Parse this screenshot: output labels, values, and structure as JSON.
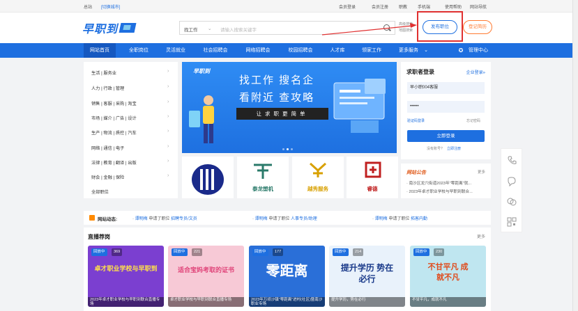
{
  "topbar": {
    "location": "总站",
    "switch_city": "[切换城市]",
    "links": [
      "会员登录",
      "会员注册",
      "职教",
      "手机端",
      "使用帮助",
      "网站导航"
    ]
  },
  "header": {
    "logo_text": "早职到",
    "search_type": "找工作",
    "search_placeholder": "请输入搜索关键字",
    "adv1": "高级搜索",
    "adv2": "地图搜索",
    "post_job": "发布职位",
    "post_resume": "登记简历"
  },
  "nav": {
    "items": [
      "网站首页",
      "全职岗位",
      "灵活就业",
      "社会招聘会",
      "网络招聘会",
      "校园招聘会",
      "人才库",
      "领家工作",
      "更多服务"
    ],
    "admin": "管理中心"
  },
  "categories": [
    "生活 | 服务业",
    "人力 | 行政 | 管理",
    "销售 | 客服 | 采购 | 淘宝",
    "市场 | 媒介 | 广告 | 设计",
    "生产 | 物流 | 质控 | 汽车",
    "网络 | 通信 | 电子",
    "法律 | 教育 | 翻译 | 出版",
    "财会 | 金融 | 保险",
    "全部职位"
  ],
  "banner": {
    "logo": "早职到",
    "line1": "找工作  搜名企",
    "line2": "看附近  查攻略",
    "slogan": "让求职更简单"
  },
  "companies": [
    {
      "name": "",
      "color": "#1a2a8a"
    },
    {
      "name": "泰龙塑机",
      "color": "#2a7a6a"
    },
    {
      "name": "越秀服务",
      "color": "#d8a000"
    },
    {
      "name": "睿德",
      "color": "#c02020"
    }
  ],
  "login": {
    "title": "求职者登录",
    "enterprise": "企业登录»",
    "username": "早小职004客服",
    "password": "••••••",
    "sms_login": "验证码登录",
    "forgot": "忘记密码",
    "button": "立即登录",
    "no_account": "没有账号?",
    "register": "立即注册"
  },
  "notice": {
    "title": "网站公告",
    "more": "更多",
    "items": [
      "· 南沙区龙穴街道2023年\"零距离\"就...",
      "· 2023年卓才职业学校与早职到联合..."
    ]
  },
  "dynamics": {
    "label": "网站动态:",
    "entries": [
      {
        "user": "谭明梅",
        "action": "申请了职位",
        "job": "招聘专员/文员"
      },
      {
        "user": "谭明梅",
        "action": "申请了职位",
        "job": "人事专员/助理"
      },
      {
        "user": "谭明梅",
        "action": "申请了职位",
        "job": "拓客内勤"
      }
    ]
  },
  "live": {
    "title": "直播荐岗",
    "more": "更多",
    "cards": [
      {
        "badge": "回放中",
        "count": "369",
        "big": "卓才职业学校与早职到",
        "caption": "2023年卓才职业学校与早职到联合直播专场",
        "bg": "#7b3fd0"
      },
      {
        "badge": "回放中",
        "count": "221",
        "big": "适合宝妈考取的证书",
        "caption": "卓才职业学校与早职到联合直播专场",
        "bg": "#f7c9d6"
      },
      {
        "badge": "回放中",
        "count": "177",
        "big": "零距离",
        "caption": "2023年万顷沙镇\"零距离\"进村(社区)暨南沙职业专场",
        "bg": "#2a6fd8"
      },
      {
        "badge": "回放中",
        "count": "214",
        "big": "提升学历 势在必行",
        "caption": "提升学历，势在必行",
        "bg": "#e9f2fb"
      },
      {
        "badge": "回放中",
        "count": "230",
        "big": "不甘平凡 成就不凡",
        "caption": "不甘平凡，成就不凡",
        "bg": "#bfe6f0"
      }
    ]
  }
}
